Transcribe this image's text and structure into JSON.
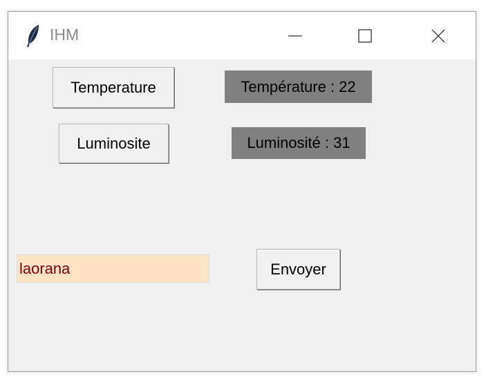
{
  "window": {
    "title": "IHM",
    "icon": "feather-icon",
    "controls": [
      "minimize-icon",
      "maximize-icon",
      "close-icon"
    ]
  },
  "buttons": {
    "temperature": "Temperature",
    "luminosite": "Luminosite",
    "envoyer": "Envoyer"
  },
  "labels": {
    "temperature": "Température : 22",
    "luminosite": "Luminosité : 31"
  },
  "entry": {
    "value": "laorana"
  },
  "colors": {
    "label_bg": "#808080",
    "entry_bg": "#ffe4c4",
    "entry_text": "#8b0000",
    "window_bg": "#f0f0f0"
  }
}
